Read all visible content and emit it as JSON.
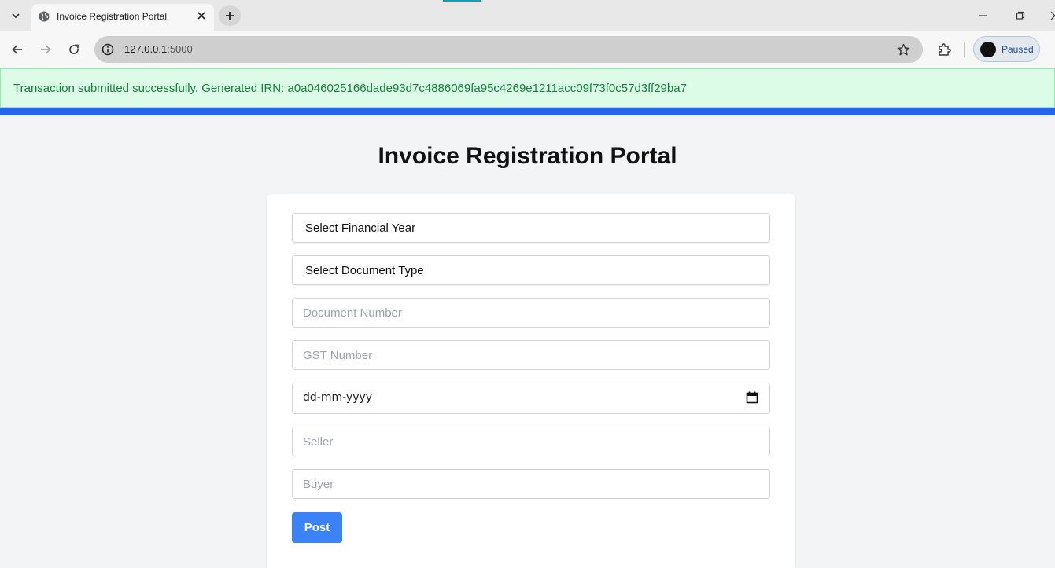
{
  "browser": {
    "tab_title": "Invoice Registration Portal",
    "url_host": "127.0.0.1",
    "url_port": ":5000",
    "profile_label": "Paused"
  },
  "alert": {
    "message": "Transaction submitted successfully. Generated IRN: a0a046025166dade93d7c4886069fa95c4269e1211acc09f73f0c57d3ff29ba7",
    "color": "#15803d",
    "background": "#dcfce7"
  },
  "page": {
    "title": "Invoice Registration Portal"
  },
  "form": {
    "financial_year": {
      "selected": "Select Financial Year"
    },
    "document_type": {
      "selected": "Select Document Type"
    },
    "document_number": {
      "placeholder": "Document Number",
      "value": ""
    },
    "gst_number": {
      "placeholder": "GST Number",
      "value": ""
    },
    "date": {
      "placeholder": "dd-mm-yyyy"
    },
    "seller": {
      "placeholder": "Seller",
      "value": ""
    },
    "buyer": {
      "placeholder": "Buyer",
      "value": ""
    },
    "submit_label": "Post",
    "accent_color": "#3b82f6"
  },
  "icons": {
    "tab_list": "chevron-down-icon",
    "favicon": "globe-icon",
    "tab_close": "close-icon",
    "new_tab": "plus-icon",
    "back": "arrow-left-icon",
    "forward": "arrow-right-icon",
    "reload": "reload-icon",
    "site_info": "info-icon",
    "bookmark": "star-icon",
    "extensions": "puzzle-icon",
    "calendar": "calendar-icon"
  }
}
